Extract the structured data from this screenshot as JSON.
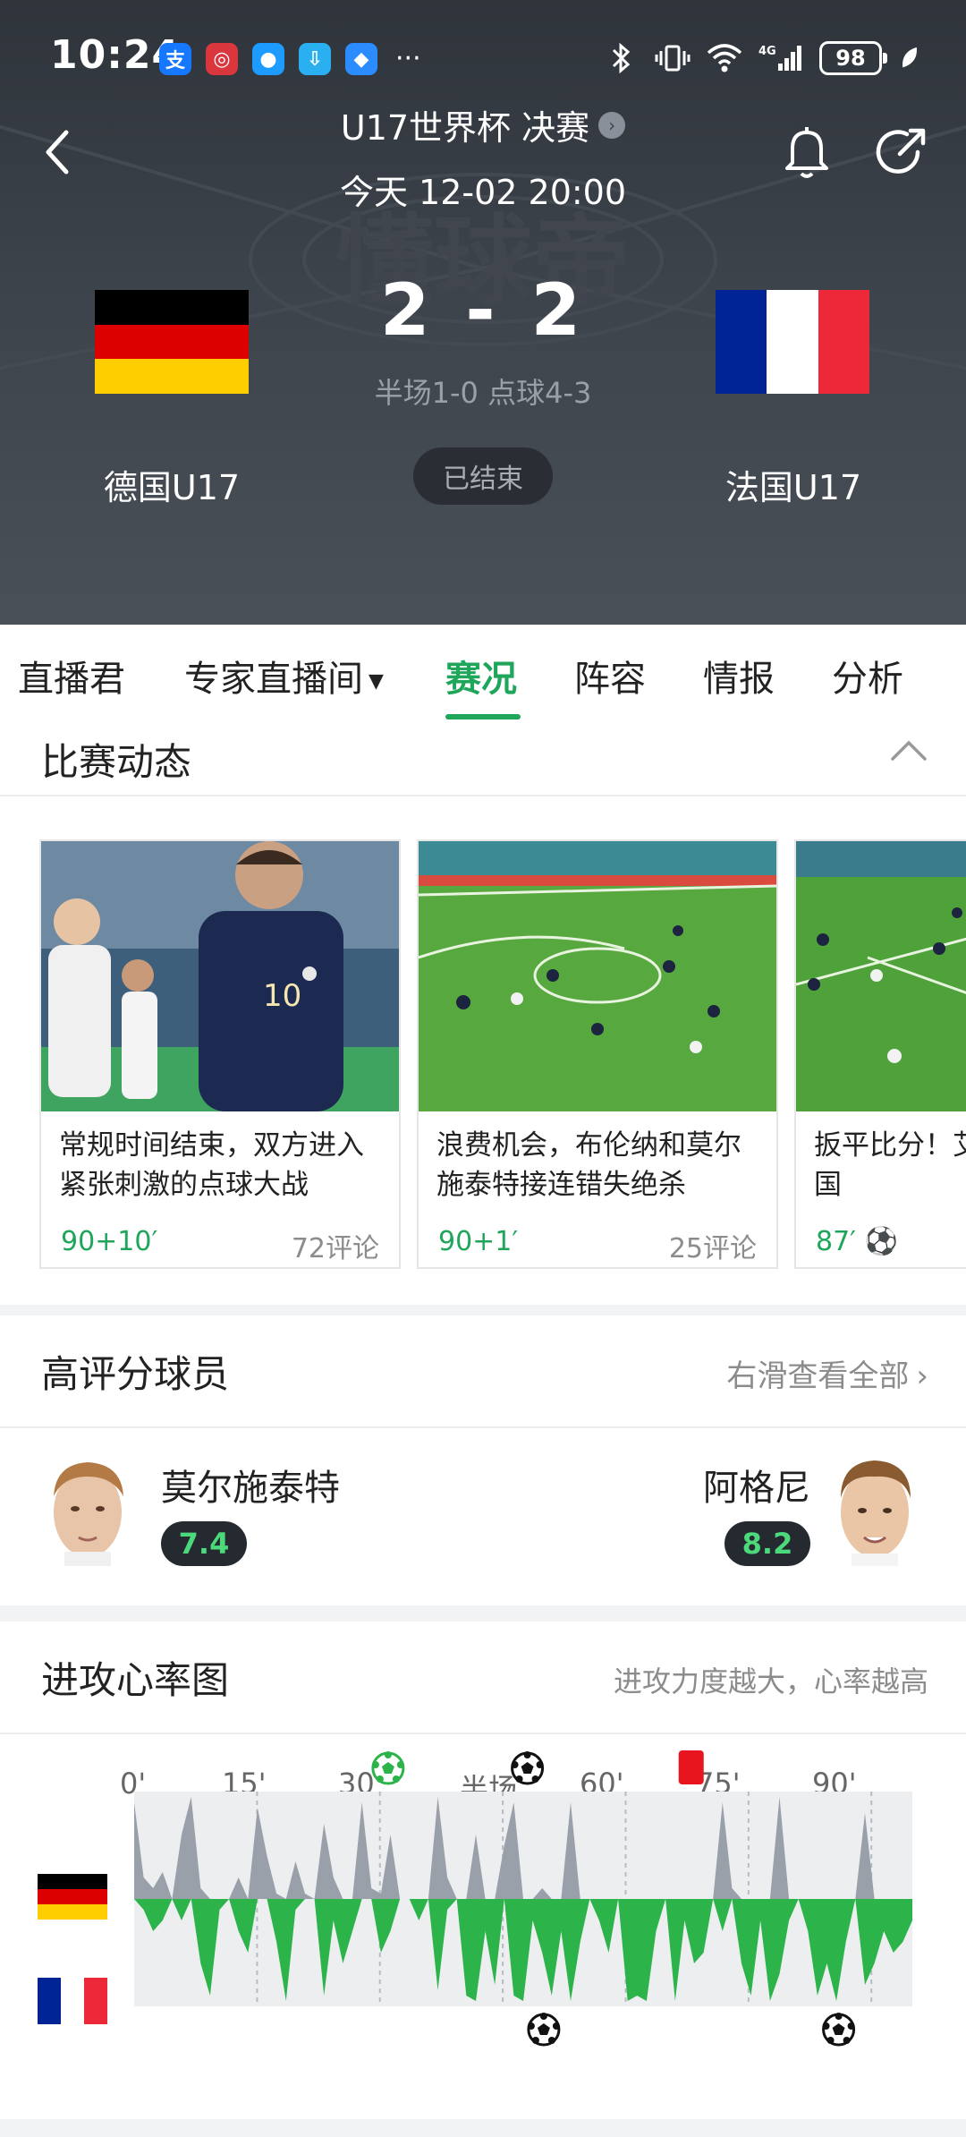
{
  "status_bar": {
    "time": "10:24",
    "battery": "98",
    "app_icons": [
      {
        "name": "alipay-icon",
        "glyph": "支",
        "color": "#1677ff"
      },
      {
        "name": "news-app-icon",
        "glyph": "◎",
        "color": "#d9363e"
      },
      {
        "name": "message-app-icon",
        "glyph": "●",
        "color": "#1e9bff"
      },
      {
        "name": "download-app-icon",
        "glyph": "⇩",
        "color": "#2ab0f0"
      },
      {
        "name": "browser-app-icon",
        "glyph": "◆",
        "color": "#2a8cff"
      }
    ],
    "more": "···"
  },
  "header": {
    "title": "U17世界杯 决赛",
    "datetime": "今天 12-02 20:00",
    "home_team": "德国U17",
    "away_team": "法国U17",
    "score": "2 - 2",
    "score_detail": "半场1-0 点球4-3",
    "match_status": "已结束"
  },
  "tabs": [
    {
      "label": "直播君",
      "active": false
    },
    {
      "label": "专家直播间",
      "active": false,
      "dropdown": true
    },
    {
      "label": "赛况",
      "active": true
    },
    {
      "label": "阵容",
      "active": false
    },
    {
      "label": "情报",
      "active": false
    },
    {
      "label": "分析",
      "active": false
    }
  ],
  "match_dynamics": {
    "title": "比赛动态",
    "cards": [
      {
        "text": "常规时间结束，双方进入紧张刺激的点球大战",
        "minute": "90+10′",
        "comments": "72评论"
      },
      {
        "text": "浪费机会，布伦纳和莫尔施泰特接连错失绝杀",
        "minute": "90+1′",
        "comments": "25评论"
      },
      {
        "text": "扳平比分！艾古进球，法国",
        "minute": "87′",
        "comments": ""
      }
    ]
  },
  "top_players": {
    "title": "高评分球员",
    "action": "右滑查看全部",
    "left": {
      "name": "莫尔施泰特",
      "rating": "7.4"
    },
    "right": {
      "name": "阿格尼",
      "rating": "8.2"
    }
  },
  "heart_rate": {
    "title": "进攻心率图",
    "subtitle": "进攻力度越大，心率越高",
    "ticks": [
      "0'",
      "15'",
      "30'",
      "半场",
      "60'",
      "75'",
      "90'"
    ],
    "colors": {
      "home": "#9aa0aa",
      "away": "#2cb34a",
      "background": "#eceef0"
    },
    "events": [
      {
        "team": "home",
        "type": "goal-own-green",
        "minute": 31
      },
      {
        "team": "home",
        "type": "goal",
        "minute": 48
      },
      {
        "team": "home",
        "type": "red-card",
        "minute": 68
      },
      {
        "team": "away",
        "type": "goal",
        "minute": 50
      },
      {
        "team": "away",
        "type": "goal",
        "minute": 86
      }
    ],
    "home_series": [
      0.9,
      0.2,
      0.1,
      0.25,
      0.0,
      0.6,
      0.95,
      0.1,
      0.0,
      0.0,
      0.0,
      0.2,
      0.0,
      0.85,
      0.4,
      0.05,
      0.0,
      0.35,
      0.05,
      0.0,
      0.7,
      0.2,
      0.0,
      0.0,
      0.9,
      0.1,
      0.05,
      0.6,
      0.0,
      0.0,
      0.0,
      0.0,
      0.95,
      0.2,
      0.0,
      0.0,
      0.6,
      0.0,
      0.0,
      0.5,
      0.9,
      0.0,
      0.0,
      0.1,
      0.0,
      0.0,
      0.9,
      0.0,
      0.0,
      0.0,
      0.0,
      0.0,
      0.0,
      0.0,
      0.0,
      0.0,
      0.0,
      0.0,
      0.0,
      0.0,
      0.0,
      0.0,
      0.9,
      0.1,
      0.0,
      0.0,
      0.0,
      0.0,
      0.95,
      0.0,
      0.0,
      0.0,
      0.0,
      0.0,
      0.0,
      0.0,
      0.0,
      0.8,
      0.0,
      0.0,
      0.0,
      0.0,
      0.0
    ],
    "away_series": [
      0.0,
      0.1,
      0.3,
      0.2,
      0.0,
      0.2,
      0.0,
      0.6,
      0.9,
      0.1,
      0.0,
      0.3,
      0.5,
      0.0,
      0.0,
      0.4,
      0.95,
      0.1,
      0.0,
      0.0,
      0.9,
      0.2,
      0.6,
      0.3,
      0.0,
      0.0,
      0.5,
      0.3,
      0.0,
      0.0,
      0.2,
      0.0,
      0.85,
      0.1,
      0.0,
      0.9,
      0.95,
      0.3,
      0.8,
      0.0,
      0.9,
      0.95,
      0.2,
      0.5,
      0.9,
      0.3,
      0.95,
      0.4,
      0.0,
      0.2,
      0.5,
      0.0,
      0.95,
      0.9,
      0.95,
      0.3,
      0.0,
      0.95,
      0.2,
      0.6,
      0.5,
      0.0,
      0.3,
      0.0,
      0.6,
      0.9,
      0.2,
      0.95,
      0.7,
      0.2,
      0.0,
      0.3,
      0.9,
      0.6,
      0.95,
      0.4,
      0.0,
      0.8,
      0.6,
      0.3,
      0.5,
      0.4,
      0.2
    ]
  }
}
